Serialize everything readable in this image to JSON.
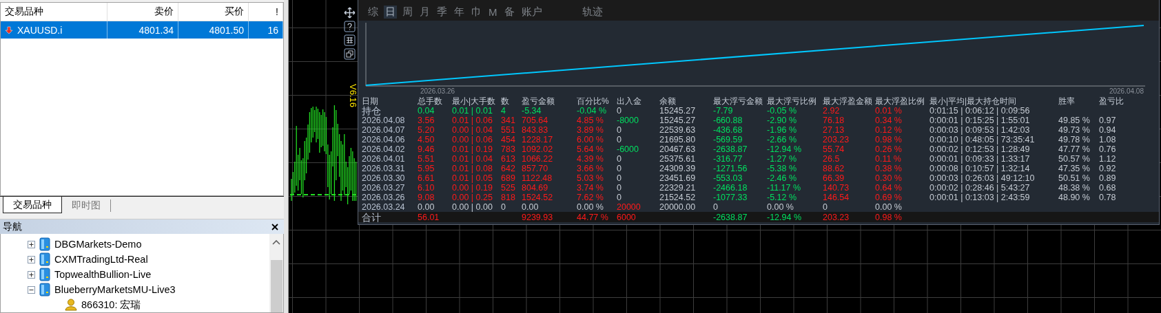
{
  "market_watch": {
    "columns": [
      "交易品种",
      "卖价",
      "买价",
      "!"
    ],
    "rows": [
      {
        "symbol": "XAUUSD.i",
        "bid": "4801.34",
        "ask": "4801.50",
        "spread": "16",
        "selected": true,
        "falling": true
      }
    ]
  },
  "market_watch_tabs": [
    {
      "label": "交易品种",
      "selected": true
    },
    {
      "label": "即时图",
      "selected": false
    }
  ],
  "navigator": {
    "title": "导航",
    "items": [
      {
        "label": "DBGMarkets-Demo",
        "kind": "server",
        "expanded": false
      },
      {
        "label": "CXMTradingLtd-Real",
        "kind": "server",
        "expanded": false
      },
      {
        "label": "TopwealthBullion-Live",
        "kind": "server",
        "expanded": false
      },
      {
        "label": "BlueberryMarketsMU-Live3",
        "kind": "server",
        "expanded": true,
        "children": [
          {
            "label": "866310: 宏瑞",
            "kind": "account"
          }
        ]
      }
    ]
  },
  "chart": {
    "version": "V6.16"
  },
  "stats_panel": {
    "tabs": [
      {
        "label": "综",
        "selected": false
      },
      {
        "label": "日",
        "selected": true
      },
      {
        "label": "周",
        "selected": false
      },
      {
        "label": "月",
        "selected": false
      },
      {
        "label": "季",
        "selected": false
      },
      {
        "label": "年",
        "selected": false
      },
      {
        "label": "巾",
        "selected": false
      },
      {
        "label": "M",
        "selected": false
      },
      {
        "label": "备",
        "selected": false
      },
      {
        "label": "账户",
        "selected": false
      },
      {
        "label": "轨迹",
        "selected": false
      }
    ],
    "curve": {
      "start_date": "2026.03.26",
      "end_date": "2026.04.08"
    },
    "columns": [
      "日期",
      "总手数",
      "最小|大手数",
      "数",
      "盈亏金额",
      "百分比%",
      "出入金",
      "余额",
      "最大浮亏金额",
      "最大浮亏比例",
      "最大浮盈金额",
      "最大浮盈比例",
      "最小|平均|最大持仓时间",
      "胜率",
      "盈亏比"
    ],
    "rows": [
      {
        "kind": "position",
        "cells": [
          "持仓",
          "0.04",
          "0.01 | 0.01",
          "4",
          "-5.34",
          "-0.04 %",
          {
            "text": "0",
            "color": "#c6ccd4"
          },
          "15245.27",
          "-7.79",
          "-0.05 %",
          "2.92",
          "0.01 %",
          "0:01:15 | 0:06:12 | 0:09:56",
          null,
          null
        ]
      },
      {
        "kind": "day",
        "cells": [
          "2026.04.08",
          "3.56",
          "0.01 | 0.06",
          "341",
          "705.64",
          "4.85 %",
          {
            "text": "-8000",
            "color": "#00e060"
          },
          "15245.27",
          "-660.88",
          "-2.90 %",
          "76.18",
          "0.34 %",
          "0:00:01 | 0:15:25 | 1:55:01",
          "49.85 %",
          "0.97"
        ]
      },
      {
        "kind": "day",
        "cells": [
          "2026.04.07",
          "5.20",
          "0.00 | 0.04",
          "551",
          "843.83",
          "3.89 %",
          {
            "text": "0",
            "color": "#c6ccd4"
          },
          "22539.63",
          "-436.68",
          "-1.96 %",
          "27.13",
          "0.12 %",
          "0:00:03 | 0:09:53 | 1:42:03",
          "49.73 %",
          "0.94"
        ]
      },
      {
        "kind": "day",
        "cells": [
          "2026.04.06",
          "4.50",
          "0.00 | 0.06",
          "454",
          "1228.17",
          "6.00 %",
          {
            "text": "0",
            "color": "#c6ccd4"
          },
          "21695.80",
          "-569.59",
          "-2.66 %",
          "203.23",
          "0.98 %",
          "0:00:10 | 0:48:05 | 73:35:41",
          "49.78 %",
          "1.08"
        ]
      },
      {
        "kind": "day",
        "cells": [
          "2026.04.02",
          "9.46",
          "0.01 | 0.19",
          "783",
          "1092.02",
          "5.64 %",
          {
            "text": "-6000",
            "color": "#00e060"
          },
          "20467.63",
          "-2638.87",
          "-12.94 %",
          "55.74",
          "0.26 %",
          "0:00:02 | 0:12:53 | 1:28:49",
          "47.77 %",
          "0.76"
        ]
      },
      {
        "kind": "day",
        "cells": [
          "2026.04.01",
          "5.51",
          "0.01 | 0.04",
          "613",
          "1066.22",
          "4.39 %",
          {
            "text": "0",
            "color": "#c6ccd4"
          },
          "25375.61",
          "-316.77",
          "-1.27 %",
          "26.5",
          "0.11 %",
          "0:00:01 | 0:09:33 | 1:33:17",
          "50.57 %",
          "1.12"
        ]
      },
      {
        "kind": "day",
        "cells": [
          "2026.03.31",
          "5.95",
          "0.01 | 0.08",
          "642",
          "857.70",
          "3.66 %",
          {
            "text": "0",
            "color": "#c6ccd4"
          },
          "24309.39",
          "-1271.56",
          "-5.38 %",
          "88.62",
          "0.38 %",
          "0:00:08 | 0:10:57 | 1:32:14",
          "47.35 %",
          "0.92"
        ]
      },
      {
        "kind": "day",
        "cells": [
          "2026.03.30",
          "6.61",
          "0.01 | 0.05",
          "689",
          "1122.48",
          "5.03 %",
          {
            "text": "0",
            "color": "#c6ccd4"
          },
          "23451.69",
          "-553.03",
          "-2.46 %",
          "66.39",
          "0.30 %",
          "0:00:03 | 0:26:03 | 49:12:10",
          "50.51 %",
          "0.89"
        ]
      },
      {
        "kind": "day",
        "cells": [
          "2026.03.27",
          "6.10",
          "0.00 | 0.19",
          "525",
          "804.69",
          "3.74 %",
          {
            "text": "0",
            "color": "#c6ccd4"
          },
          "22329.21",
          "-2466.18",
          "-11.17 %",
          "140.73",
          "0.64 %",
          "0:00:02 | 0:28:46 | 5:43:27",
          "48.38 %",
          "0.68"
        ]
      },
      {
        "kind": "day",
        "cells": [
          "2026.03.26",
          "9.08",
          "0.00 | 0.25",
          "818",
          "1524.52",
          "7.62 %",
          {
            "text": "0",
            "color": "#c6ccd4"
          },
          "21524.52",
          "-1077.33",
          "-5.12 %",
          "146.54",
          "0.69 %",
          "0:00:01 | 0:13:03 | 2:43:59",
          "48.90 %",
          "0.78"
        ]
      },
      {
        "kind": "empty",
        "cells": [
          "2026.03.24",
          "0.00",
          "0.00 | 0.00",
          "0",
          "0.00",
          "0.00 %",
          {
            "text": "20000",
            "color": "#ff1a1a"
          },
          "20000.00",
          "0",
          "0.00 %",
          "0",
          "0.00 %",
          null,
          null,
          null
        ]
      },
      {
        "kind": "total",
        "cells": [
          "合计",
          "56.01",
          null,
          null,
          "9239.93",
          "44.77 %",
          {
            "text": "6000",
            "color": "#ff1a1a"
          },
          null,
          "-2638.87",
          "-12.94 %",
          "203.23",
          "0.98 %",
          null,
          null,
          null
        ]
      }
    ]
  }
}
